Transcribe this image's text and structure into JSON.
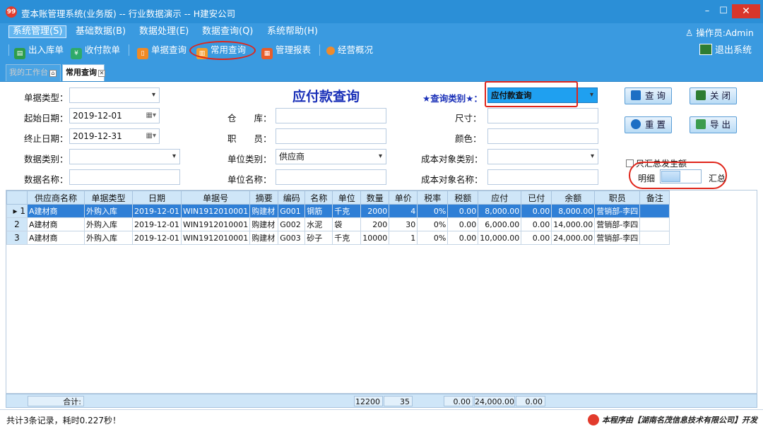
{
  "window": {
    "title": "壹本账管理系统(业务版) -- 行业数据演示 -- H建安公司",
    "logo_text": "99",
    "min": "–",
    "max": "☐",
    "close": "✕"
  },
  "menu": {
    "items": [
      "系统管理(S)",
      "基础数据(B)",
      "数据处理(E)",
      "数据查询(Q)",
      "系统帮助(H)"
    ],
    "operator": "操作员:Admin"
  },
  "toolbar": {
    "items": [
      "出入库单",
      "收付款单",
      "单据查询",
      "常用查询",
      "管理报表",
      "经营概况"
    ],
    "exit": "退出系统"
  },
  "tabs": {
    "home": "我的工作台",
    "query": "常用查询"
  },
  "form": {
    "title": "应付款查询",
    "doc_type_label": "单据类型：",
    "doc_type_value": "",
    "start_label": "起始日期：",
    "start_value": "2019-12-01",
    "end_label": "终止日期：",
    "end_value": "2019-12-31",
    "data_cat_label": "数据类别：",
    "data_cat_value": "",
    "data_name_label": "数据名称：",
    "data_name_value": "",
    "warehouse_label": "仓　　库：",
    "warehouse_value": "",
    "staff_label": "职　　员：",
    "staff_value": "",
    "unit_type_label": "单位类别：",
    "unit_type_value": "供应商",
    "unit_name_label": "单位名称：",
    "unit_name_value": "",
    "size_label": "尺寸：",
    "size_value": "",
    "color_label": "颜色：",
    "color_value": "",
    "cost_type_label": "成本对象类别：",
    "cost_type_value": "",
    "cost_name_label": "成本对象名称：",
    "cost_name_value": "",
    "query_type_label": "★查询类别★：",
    "query_type_value": "应付款查询",
    "btn_query": "查 询",
    "btn_close": "关 闭",
    "btn_reset": "重 置",
    "btn_export": "导 出",
    "only_sum_label": "只汇总发生额",
    "detail_label": "明细",
    "summary_label": "汇总"
  },
  "grid": {
    "columns": [
      "",
      "供应商名称",
      "单据类型",
      "日期",
      "单据号",
      "摘要",
      "编码",
      "名称",
      "单位",
      "数量",
      "单价",
      "税率",
      "税额",
      "应付",
      "已付",
      "余额",
      "职员",
      "备注"
    ],
    "rows": [
      [
        "1",
        "A建材商",
        "外购入库",
        "2019-12-01",
        "WIN1912010001",
        "购建材",
        "G001",
        "钢筋",
        "千克",
        "2000",
        "4",
        "0%",
        "0.00",
        "8,000.00",
        "0.00",
        "8,000.00",
        "营销部-李四",
        ""
      ],
      [
        "2",
        "A建材商",
        "外购入库",
        "2019-12-01",
        "WIN1912010001",
        "购建材",
        "G002",
        "水泥",
        "袋",
        "200",
        "30",
        "0%",
        "0.00",
        "6,000.00",
        "0.00",
        "14,000.00",
        "营销部-李四",
        ""
      ],
      [
        "3",
        "A建材商",
        "外购入库",
        "2019-12-01",
        "WIN1912010001",
        "购建材",
        "G003",
        "砂子",
        "千克",
        "10000",
        "1",
        "0%",
        "0.00",
        "10,000.00",
        "0.00",
        "24,000.00",
        "营销部-李四",
        ""
      ]
    ],
    "selected_row": 0
  },
  "totals": {
    "label": "合计:",
    "qty": "12200",
    "price": "35",
    "tax": "0.00",
    "payable": "24,000.00",
    "paid": "0.00"
  },
  "status": {
    "text": "共计3条记录，耗时0.227秒！",
    "credit": "本程序由【湖南名茂信息技术有限公司】开发"
  }
}
